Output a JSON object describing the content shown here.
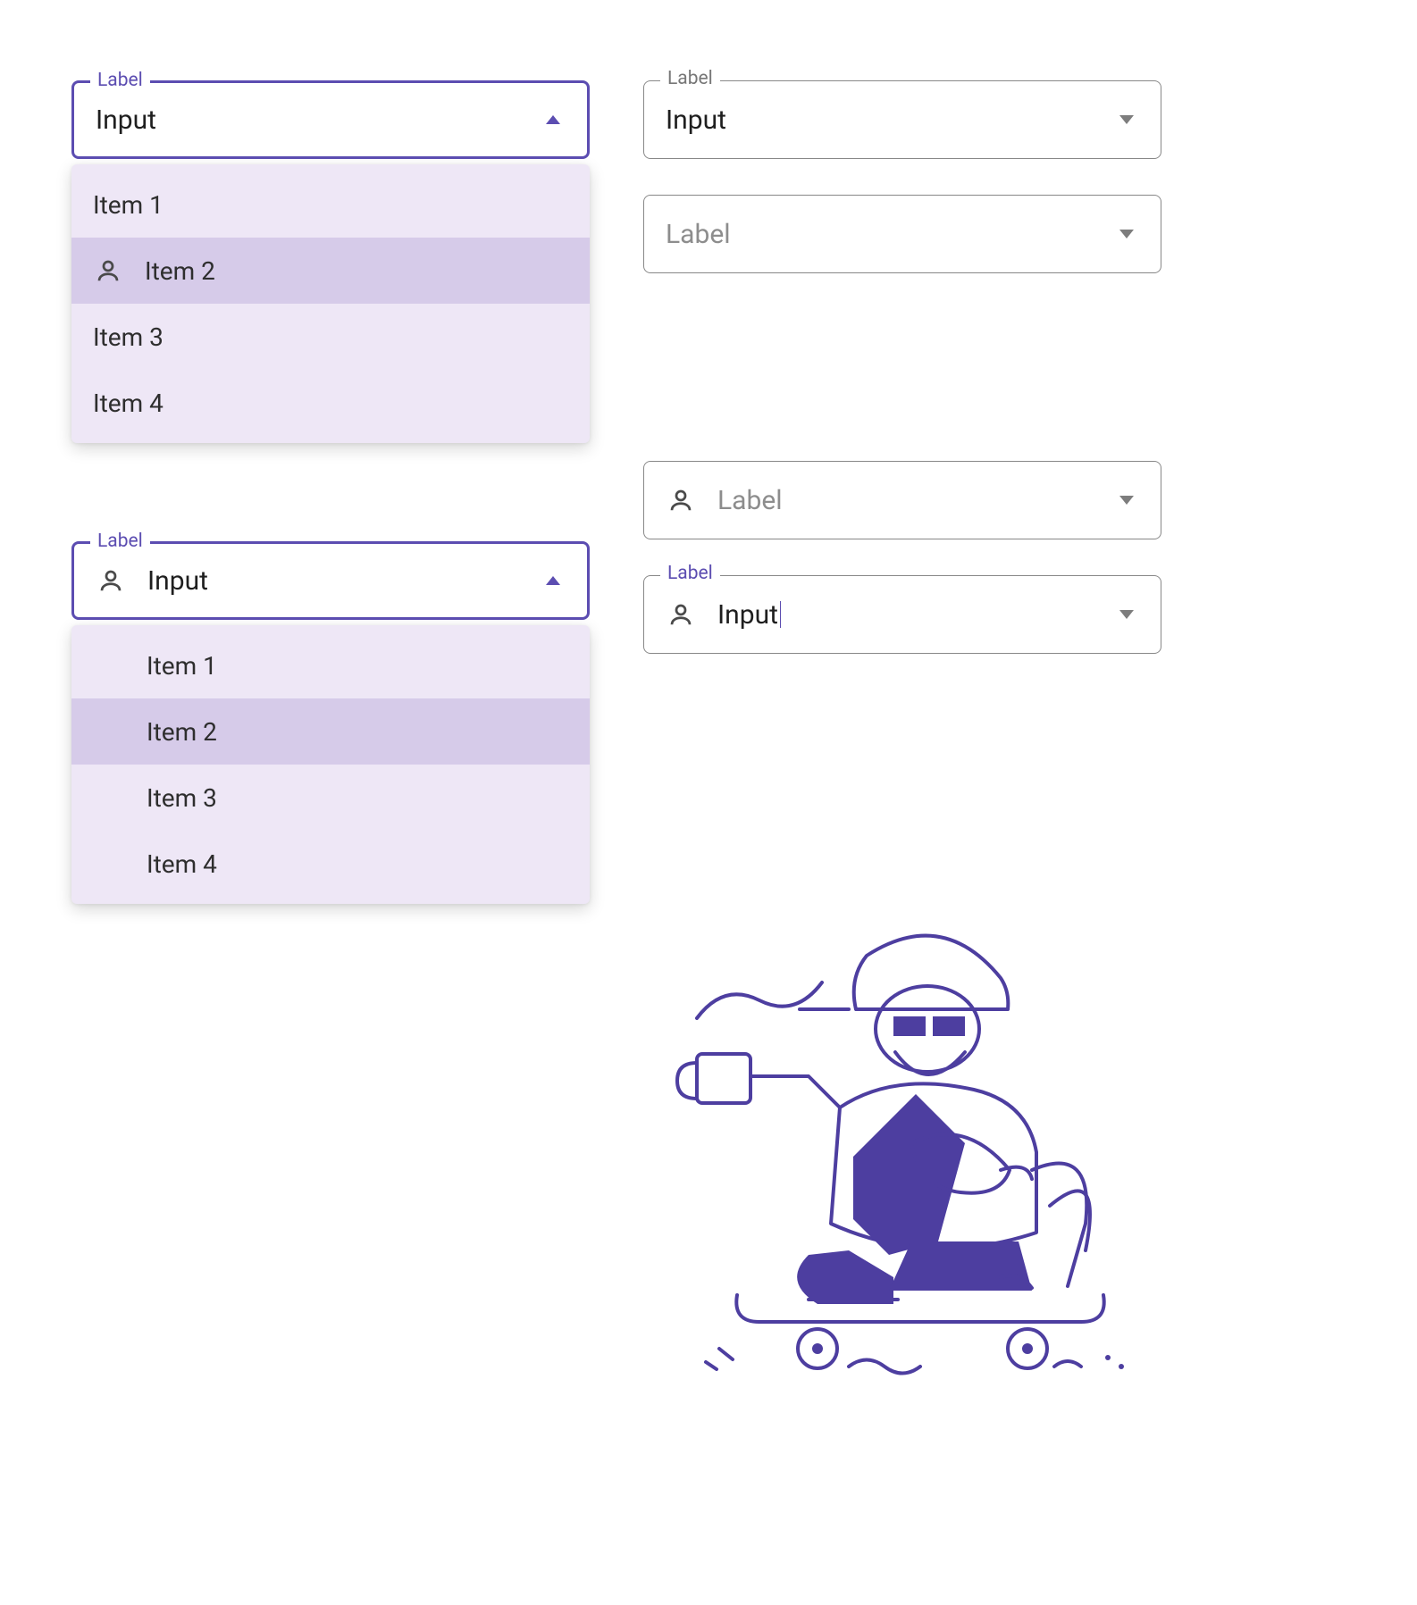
{
  "colors": {
    "primary": "#5c4db1",
    "menu_bg": "#eee7f6",
    "menu_selected": "#d6cbe9"
  },
  "select_open_1": {
    "label": "Label",
    "value": "Input",
    "items": [
      "Item 1",
      "Item 2",
      "Item 3",
      "Item 4"
    ],
    "selected_index": 1
  },
  "select_closed_1": {
    "label": "Label",
    "value": "Input"
  },
  "select_placeholder_1": {
    "placeholder": "Label"
  },
  "select_open_2": {
    "label": "Label",
    "value": "Input",
    "items": [
      "Item 1",
      "Item 2",
      "Item 3",
      "Item 4"
    ],
    "selected_index": 1
  },
  "select_placeholder_icon": {
    "placeholder": "Label"
  },
  "select_closed_icon": {
    "label": "Label",
    "value": "Input"
  }
}
